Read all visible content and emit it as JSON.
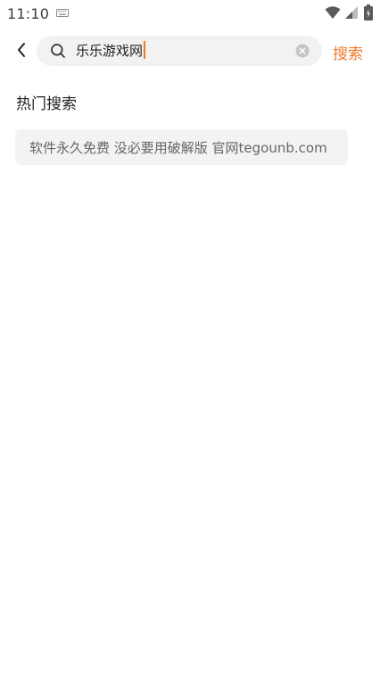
{
  "status_bar": {
    "time": "11:10",
    "icons": [
      "keyboard-icon",
      "wifi-icon",
      "signal-icon",
      "battery-icon"
    ]
  },
  "header": {
    "back_icon": "chevron-left-icon",
    "search": {
      "icon": "search-icon",
      "value": "乐乐游戏网",
      "clear_icon": "clear-icon"
    },
    "search_button_label": "搜索"
  },
  "hot_search": {
    "title": "热门搜索",
    "items": [
      {
        "label": "软件永久免费 没必要用破解版 官网tegounb.com"
      }
    ]
  },
  "colors": {
    "accent": "#ef7a2c",
    "search_bg": "#f2f2f2",
    "chip_bg": "#f3f3f3",
    "chip_text": "#666666"
  }
}
